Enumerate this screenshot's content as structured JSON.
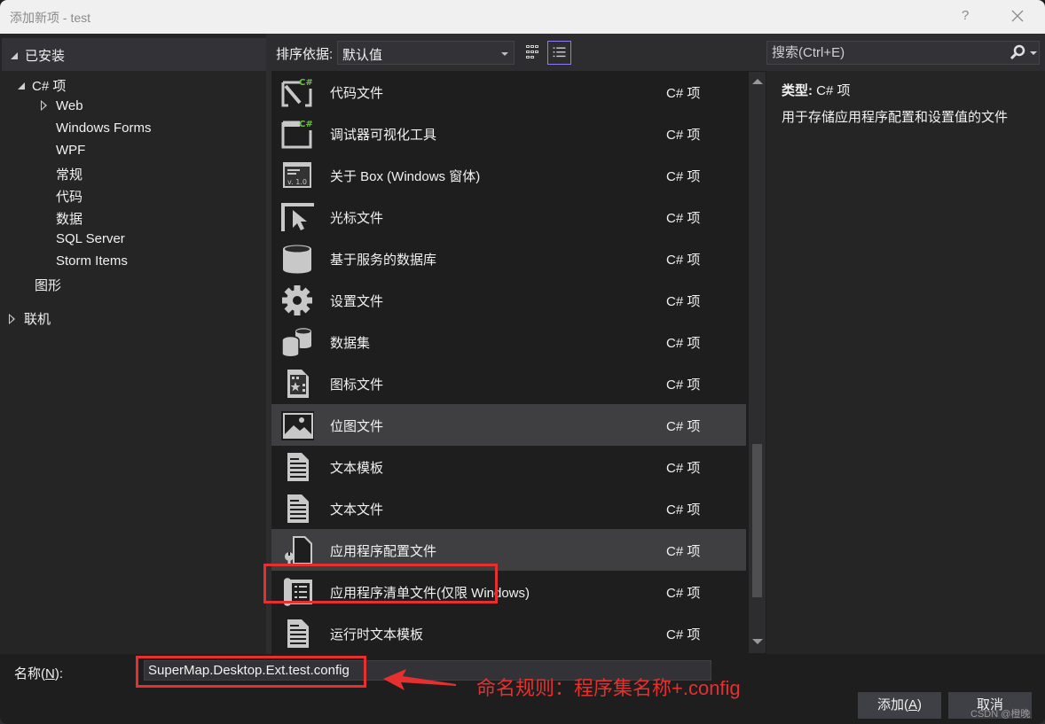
{
  "window": {
    "title": "添加新项 - test",
    "help_label": "?",
    "close_icon": "close-icon"
  },
  "tree": {
    "header": "已安装",
    "nodes": [
      {
        "label": "C# 项",
        "expanded": true
      },
      {
        "label": "Web",
        "expanded": false
      },
      {
        "label": "Windows Forms"
      },
      {
        "label": "WPF"
      },
      {
        "label": "常规"
      },
      {
        "label": "代码"
      },
      {
        "label": "数据"
      },
      {
        "label": "SQL Server"
      },
      {
        "label": "Storm Items"
      },
      {
        "label": "图形"
      },
      {
        "label": "联机",
        "expanded": false
      }
    ]
  },
  "toolbar": {
    "sort_label": "排序依据:",
    "sort_value": "默认值",
    "view_grid_icon": "grid-view-icon",
    "view_list_icon": "list-view-icon",
    "active_view": "list"
  },
  "search": {
    "placeholder": "搜索(Ctrl+E)",
    "icon": "search-icon"
  },
  "items": [
    {
      "name": "代码文件",
      "type": "C# 项",
      "icon": "code-file-icon"
    },
    {
      "name": "调试器可视化工具",
      "type": "C# 项",
      "icon": "debugger-visualizer-icon"
    },
    {
      "name": "关于 Box (Windows 窗体)",
      "type": "C# 项",
      "icon": "about-box-icon"
    },
    {
      "name": "光标文件",
      "type": "C# 项",
      "icon": "cursor-file-icon"
    },
    {
      "name": "基于服务的数据库",
      "type": "C# 项",
      "icon": "database-icon"
    },
    {
      "name": "设置文件",
      "type": "C# 项",
      "icon": "settings-gear-icon"
    },
    {
      "name": "数据集",
      "type": "C# 项",
      "icon": "dataset-icon"
    },
    {
      "name": "图标文件",
      "type": "C# 项",
      "icon": "icon-file-icon"
    },
    {
      "name": "位图文件",
      "type": "C# 项",
      "icon": "bitmap-icon",
      "hover": true
    },
    {
      "name": "文本模板",
      "type": "C# 项",
      "icon": "text-template-icon"
    },
    {
      "name": "文本文件",
      "type": "C# 项",
      "icon": "text-file-icon"
    },
    {
      "name": "应用程序配置文件",
      "type": "C# 项",
      "icon": "app-config-icon",
      "selected": true
    },
    {
      "name": "应用程序清单文件(仅限 Windows)",
      "type": "C# 项",
      "icon": "manifest-icon"
    },
    {
      "name": "运行时文本模板",
      "type": "C# 项",
      "icon": "runtime-template-icon"
    }
  ],
  "scrollbar": {
    "position_fraction": 0.75
  },
  "detail": {
    "type_label": "类型:",
    "type_value": "C# 项",
    "description": "用于存储应用程序配置和设置值的文件"
  },
  "footer": {
    "name_label_prefix": "名称(",
    "name_label_key": "N",
    "name_label_suffix": "):",
    "name_value": "SuperMap.Desktop.Ext.test.config",
    "annotation": "命名规则：程序集名称+.config",
    "add_label_prefix": "添加(",
    "add_label_key": "A",
    "add_label_suffix": ")",
    "cancel_label": "取消",
    "watermark": "CSDN @橙晚"
  },
  "colors": {
    "accent_red": "#e5302f",
    "view_active_border": "#8b7cf6",
    "csharp_green": "#6cc04a"
  }
}
